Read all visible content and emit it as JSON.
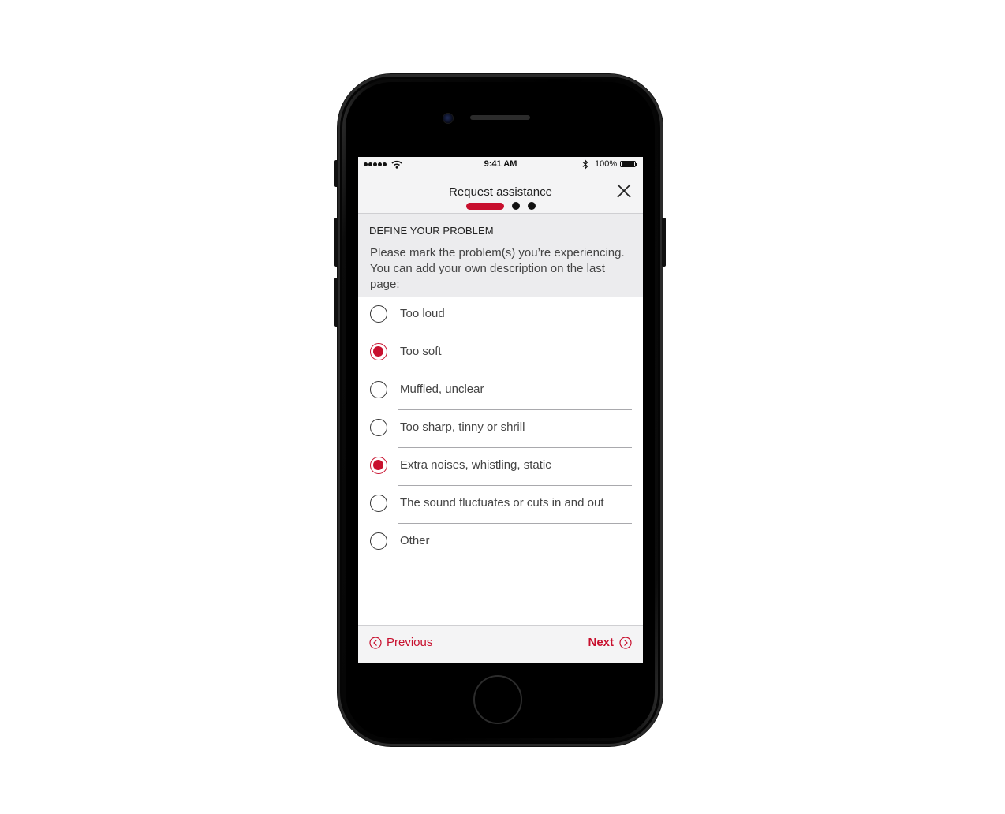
{
  "status_bar": {
    "time": "9:41 AM",
    "battery": "100%",
    "icons": [
      "signal-icon",
      "wifi-icon",
      "bluetooth-icon",
      "battery-icon"
    ]
  },
  "header": {
    "title": "Request assistance",
    "close_icon": "close-icon",
    "progress": {
      "current_step": 1,
      "total_steps": 3
    }
  },
  "intro": {
    "heading": "DEFINE YOUR PROBLEM",
    "text": "Please mark the problem(s) you’re experiencing. You can add your own description on the last page:"
  },
  "options": [
    {
      "label": "Too loud",
      "checked": false
    },
    {
      "label": "Too soft",
      "checked": true
    },
    {
      "label": "Muffled, unclear",
      "checked": false
    },
    {
      "label": "Too sharp, tinny or shrill",
      "checked": false
    },
    {
      "label": "Extra noises, whistling, static",
      "checked": true
    },
    {
      "label": "The sound fluctuates or cuts in and out",
      "checked": false
    },
    {
      "label": "Other",
      "checked": false
    }
  ],
  "footer": {
    "previous_label": "Previous",
    "next_label": "Next"
  },
  "colors": {
    "accent": "#c8102e",
    "header_bg": "#f4f4f5",
    "intro_bg": "#ececee"
  }
}
